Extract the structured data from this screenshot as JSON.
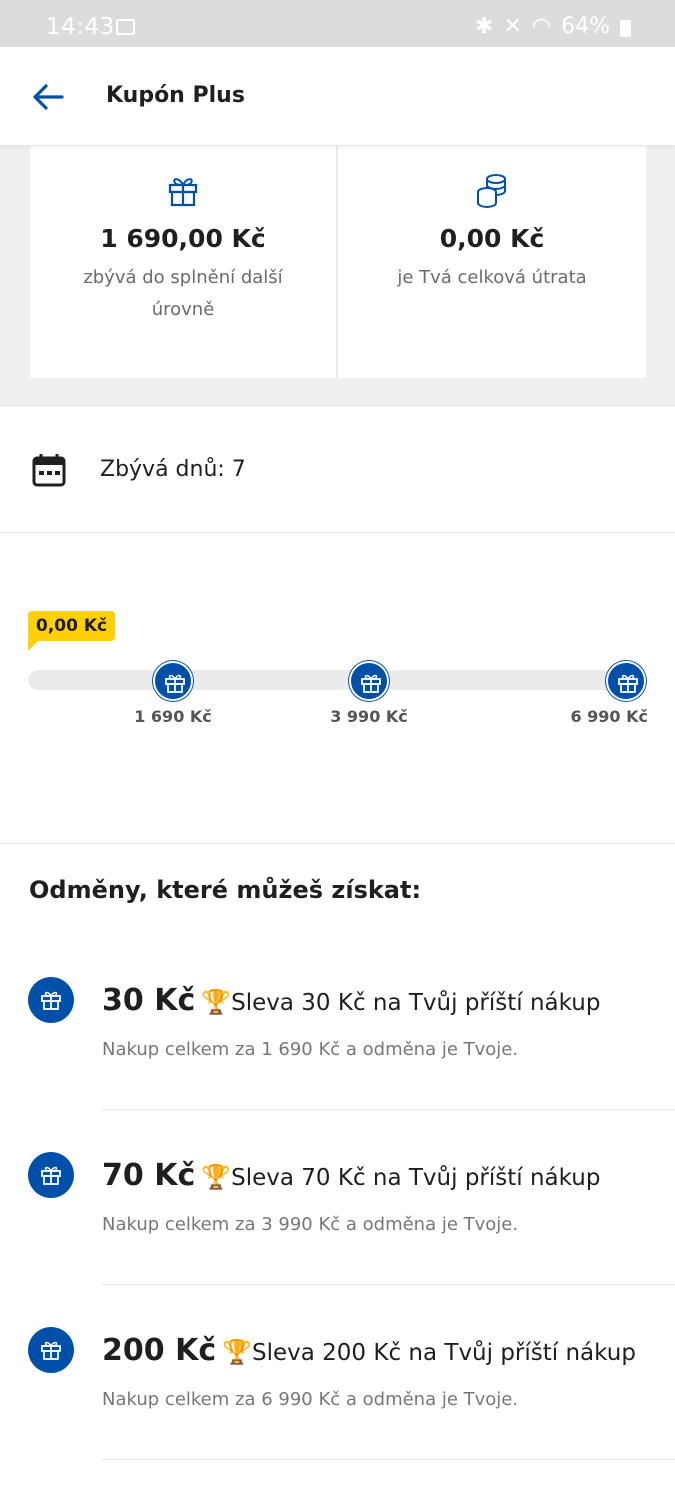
{
  "status_bar": {
    "time": "14:43",
    "battery": "64%"
  },
  "app_bar": {
    "title": "Kupón Plus"
  },
  "cards": [
    {
      "icon": "gift-icon",
      "amount": "1 690,00 Kč",
      "description": "zbývá do splnění další úrovně"
    },
    {
      "icon": "coins-icon",
      "amount": "0,00 Kč",
      "description": "je Tvá celková útrata"
    }
  ],
  "days": {
    "label": "Zbývá dnů: 7"
  },
  "progress": {
    "current_label": "0,00 Kč",
    "current_value": 0,
    "max_value": 6990,
    "milestones": [
      {
        "label": "1 690 Kč",
        "value": 1690
      },
      {
        "label": "3 990 Kč",
        "value": 3990
      },
      {
        "label": "6 990 Kč",
        "value": 6990
      }
    ]
  },
  "rewards": {
    "title": "Odměny, které můžeš získat:",
    "items": [
      {
        "amount": "30 Kč",
        "description": "Sleva 30 Kč na Tvůj příští nákup",
        "condition": "Nakup celkem za 1 690 Kč a odměna je Tvoje."
      },
      {
        "amount": "70 Kč",
        "description": "Sleva 70 Kč na Tvůj příští nákup",
        "condition": "Nakup celkem za 3 990 Kč a odměna je Tvoje."
      },
      {
        "amount": "200 Kč",
        "description": "Sleva 200 Kč na Tvůj příští nákup",
        "condition": "Nakup celkem za 6 990 Kč a odměna je Tvoje."
      }
    ]
  },
  "colors": {
    "brand_blue": "#0050aa",
    "badge_yellow": "#ffcf0a"
  }
}
